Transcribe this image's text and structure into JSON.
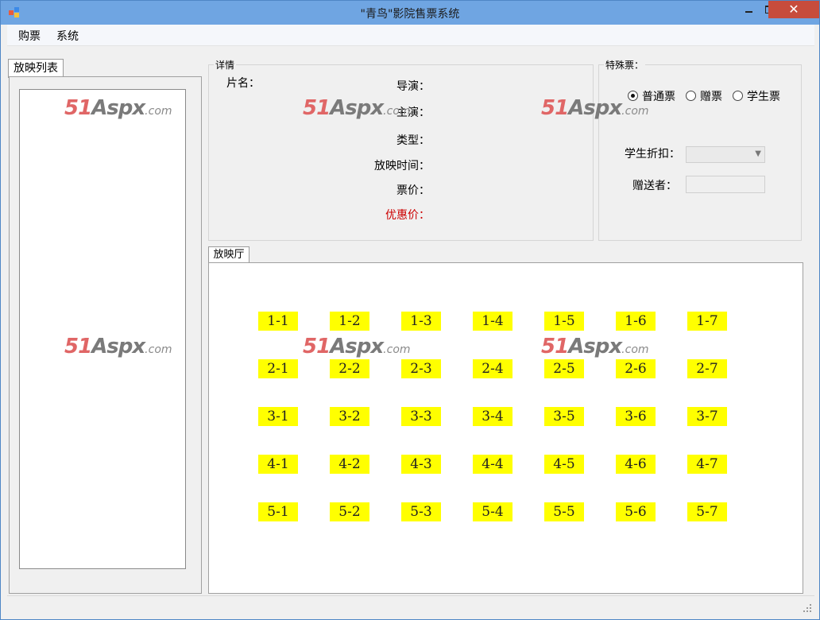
{
  "window": {
    "title": "\"青鸟\"影院售票系统",
    "close_glyph": "✕",
    "icon": "windows-form-icon"
  },
  "menu": {
    "items": [
      {
        "label": "购票"
      },
      {
        "label": "系统"
      }
    ]
  },
  "left_panel": {
    "tab_label": "放映列表"
  },
  "details": {
    "group_title": "详情",
    "labels": {
      "film_name": "片名：",
      "director": "导演：",
      "actors": "主演：",
      "genre": "类型：",
      "show_time": "放映时间：",
      "price": "票价：",
      "discount_price": "优惠价："
    }
  },
  "special_ticket": {
    "group_title": "特殊票：",
    "options": [
      {
        "label": "普通票",
        "checked": true
      },
      {
        "label": "赠票",
        "checked": false
      },
      {
        "label": "学生票",
        "checked": false
      }
    ],
    "student_discount_label": "学生折扣：",
    "gift_giver_label": "赠送者："
  },
  "hall": {
    "tab_label": "放映厅",
    "rows": [
      [
        "1-1",
        "1-2",
        "1-3",
        "1-4",
        "1-5",
        "1-6",
        "1-7"
      ],
      [
        "2-1",
        "2-2",
        "2-3",
        "2-4",
        "2-5",
        "2-6",
        "2-7"
      ],
      [
        "3-1",
        "3-2",
        "3-3",
        "3-4",
        "3-5",
        "3-6",
        "3-7"
      ],
      [
        "4-1",
        "4-2",
        "4-3",
        "4-4",
        "4-5",
        "4-6",
        "4-7"
      ],
      [
        "5-1",
        "5-2",
        "5-3",
        "5-4",
        "5-5",
        "5-6",
        "5-7"
      ]
    ]
  },
  "watermark": {
    "num": "51",
    "brand": "Aspx",
    "suffix": ".com"
  },
  "colors": {
    "seat": "#ffff00",
    "discount_label": "#cc0000",
    "titlebar": "#6fa5e2",
    "close_button": "#c74c3c"
  }
}
